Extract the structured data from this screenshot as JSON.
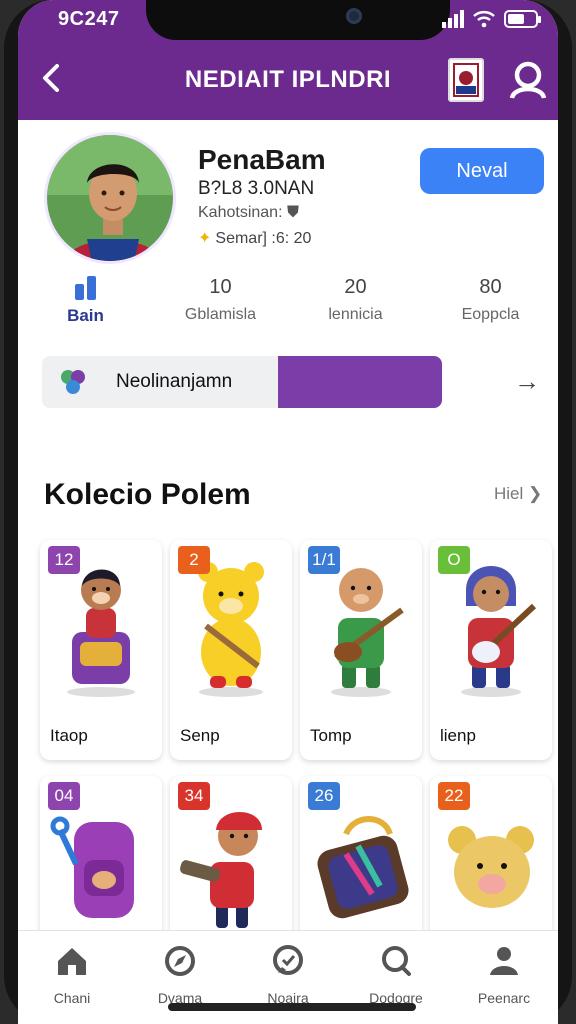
{
  "status": {
    "time": "9C247"
  },
  "appbar": {
    "title": "NEDIAIT IPLNDRI"
  },
  "profile": {
    "name": "PenaBam",
    "meta": "B?L8 3.0NAN",
    "sub": "Kahotsinan:",
    "since": "Semar] :6: 20",
    "action_label": "Neval"
  },
  "stats": [
    {
      "value": "",
      "label": "Bain"
    },
    {
      "value": "10",
      "label": "Gblamisla"
    },
    {
      "value": "20",
      "label": "lennicia"
    },
    {
      "value": "80",
      "label": "Eoppcla"
    }
  ],
  "progress": {
    "label": "Neolinanjamn",
    "fraction": 0.41
  },
  "collection": {
    "title": "Kolecio Polem",
    "more": "Hiel"
  },
  "cards": [
    {
      "num": "12",
      "name": "Itaop",
      "badge_color": "#8e44ad"
    },
    {
      "num": "2",
      "name": "Senp",
      "badge_color": "#e8601c"
    },
    {
      "num": "1/1",
      "name": "Tomp",
      "badge_color": "#3a7bd5"
    },
    {
      "num": "O",
      "name": "lienp",
      "badge_color": "#6abf3a"
    },
    {
      "num": "04",
      "name": "",
      "badge_color": "#8e44ad"
    },
    {
      "num": "34",
      "name": "",
      "badge_color": "#d9342b"
    },
    {
      "num": "26",
      "name": "",
      "badge_color": "#3a7bd5"
    },
    {
      "num": "22",
      "name": "",
      "badge_color": "#e8601c"
    }
  ],
  "nav": [
    {
      "label": "Chani",
      "icon": "home-icon"
    },
    {
      "label": "Dvama",
      "icon": "compass-icon"
    },
    {
      "label": "Noaira",
      "icon": "chat-icon"
    },
    {
      "label": "Dodogre",
      "icon": "search-icon"
    },
    {
      "label": "Peenarc",
      "icon": "person-icon"
    }
  ],
  "colors": {
    "brand": "#6c2a8e",
    "accent": "#3b82f6",
    "progress": "#7b3ea8"
  }
}
